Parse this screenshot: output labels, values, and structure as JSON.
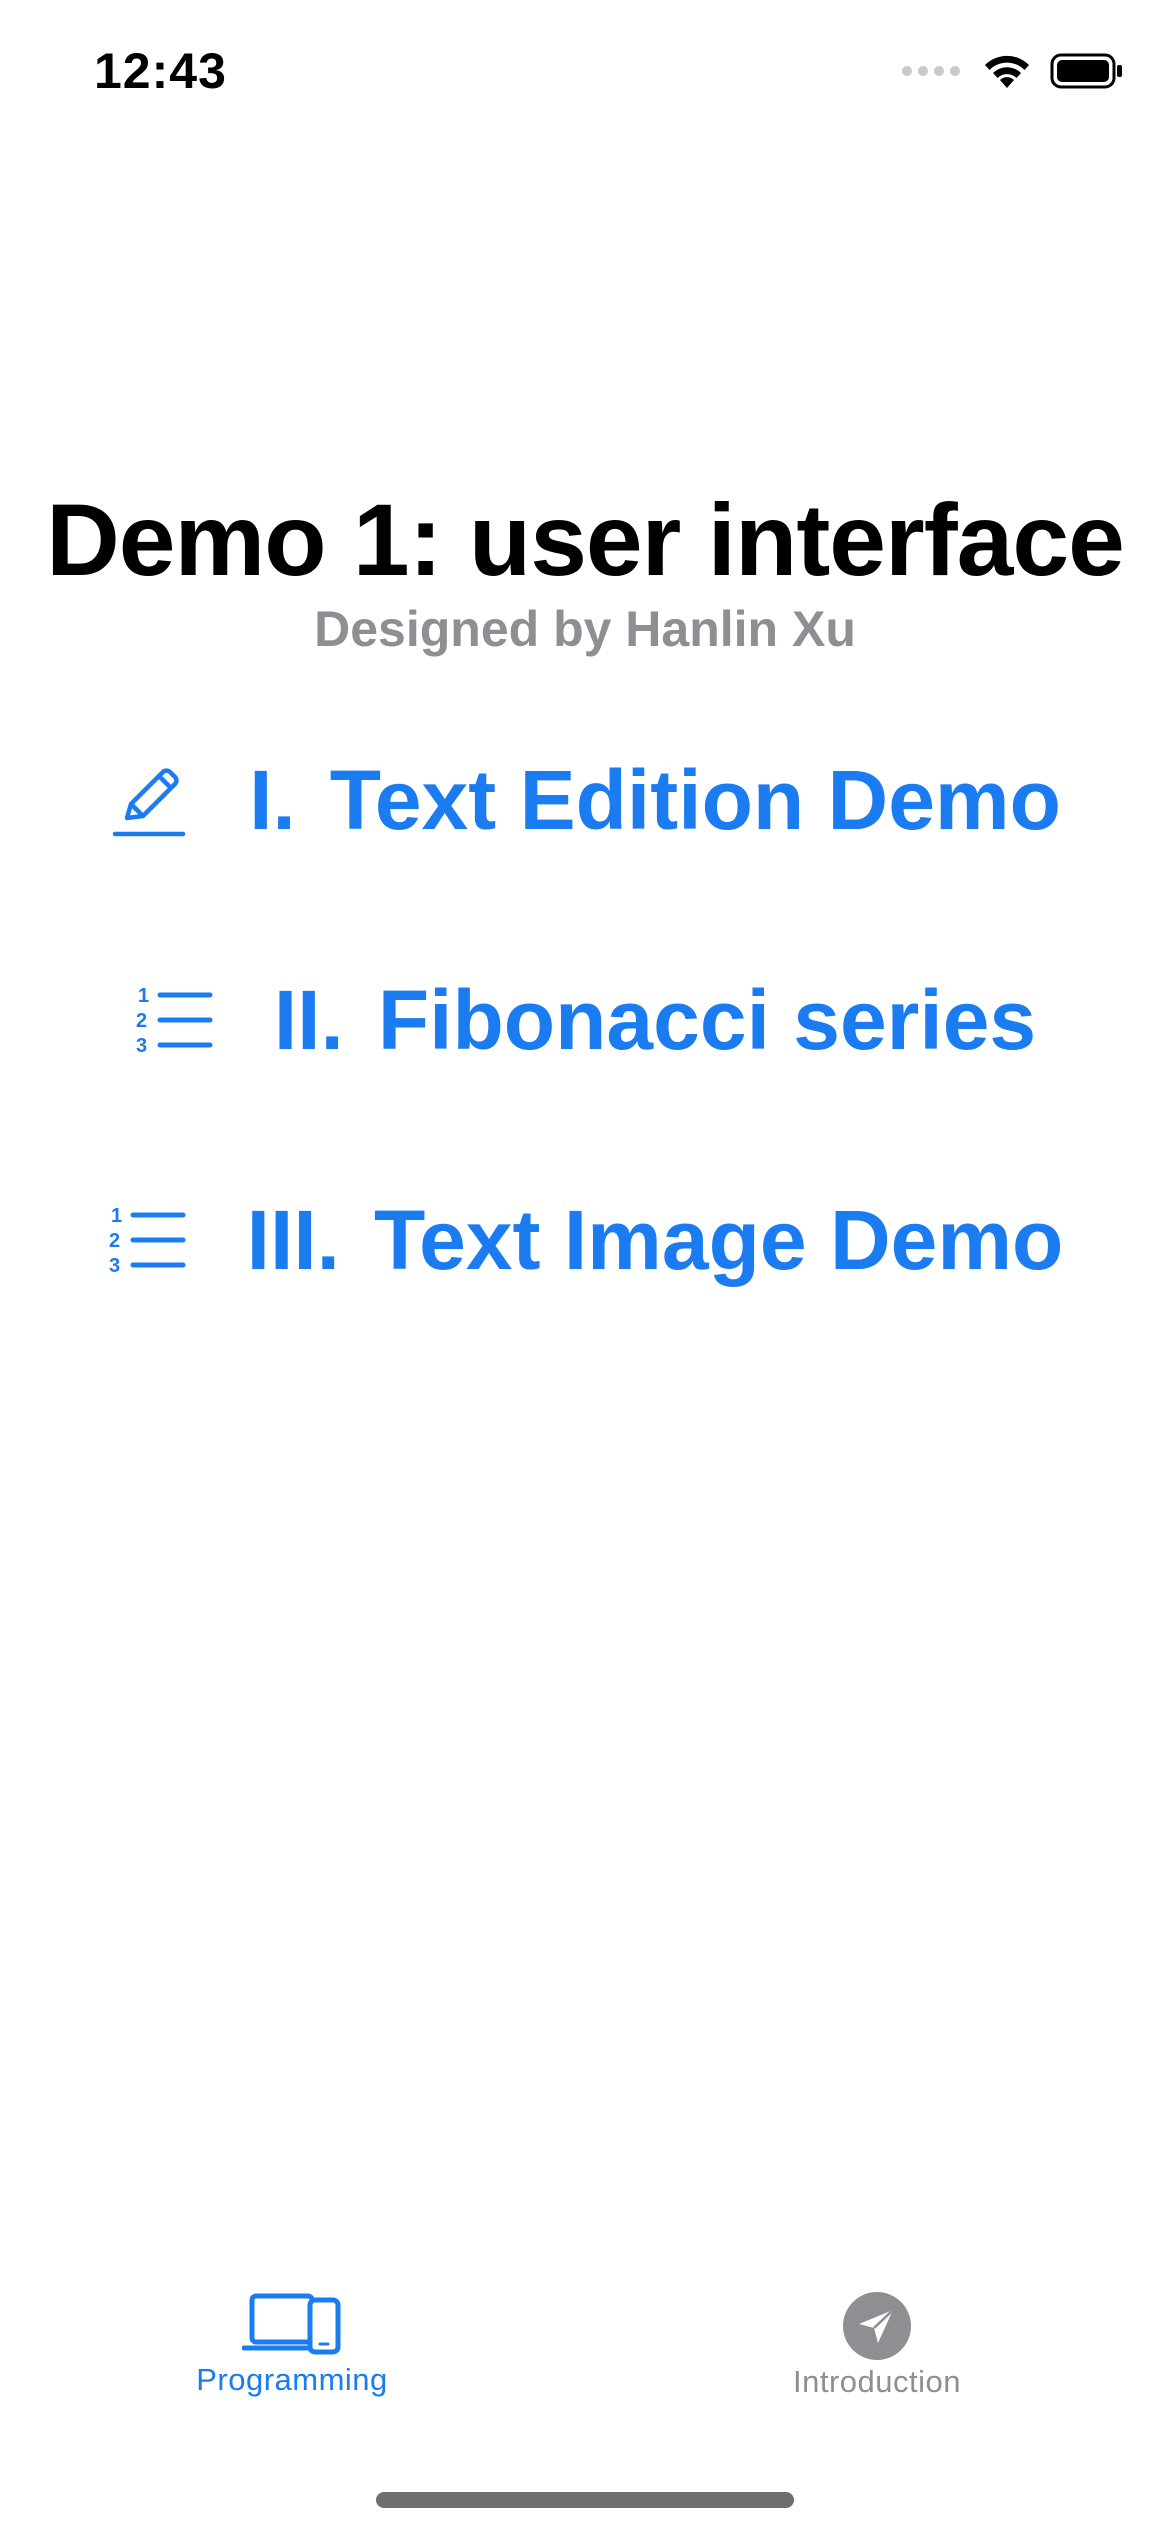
{
  "status_bar": {
    "time": "12:43"
  },
  "header": {
    "title": "Demo 1: user interface",
    "subtitle": "Designed by Hanlin Xu"
  },
  "menu": {
    "items": [
      {
        "numeral": "I.",
        "label": "Text Edition Demo",
        "icon": "pencil-icon"
      },
      {
        "numeral": "II.",
        "label": "Fibonacci series",
        "icon": "numbered-list-icon"
      },
      {
        "numeral": "III.",
        "label": "Text Image Demo",
        "icon": "numbered-list-icon"
      }
    ]
  },
  "tab_bar": {
    "tabs": [
      {
        "label": "Programming",
        "icon": "laptop-phone-icon",
        "selected": true
      },
      {
        "label": "Introduction",
        "icon": "paperplane-circle-icon",
        "selected": false
      }
    ]
  },
  "colors": {
    "accent": "#1a7cf0",
    "secondary_text": "#8e8e93",
    "primary_text": "#000000"
  }
}
